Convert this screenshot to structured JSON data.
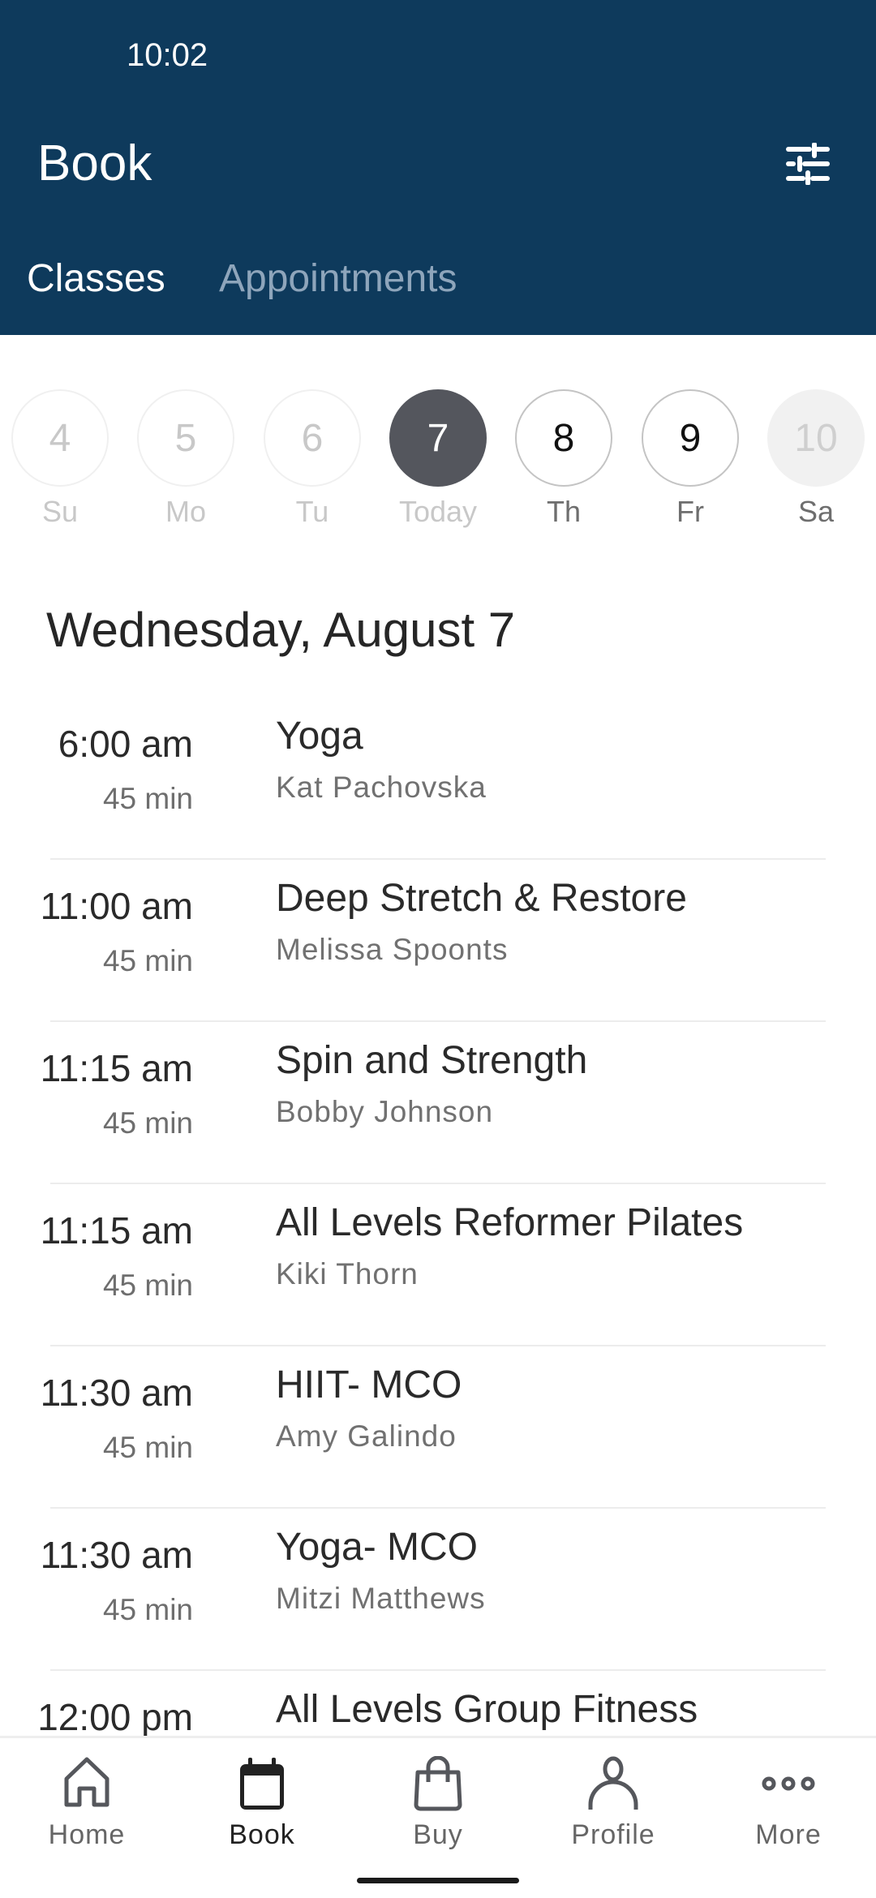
{
  "status_bar": {
    "time": "10:02"
  },
  "header": {
    "title": "Book",
    "filter_icon": "sliders-icon"
  },
  "tabs": [
    {
      "label": "Classes",
      "active": true
    },
    {
      "label": "Appointments",
      "active": false
    }
  ],
  "days": [
    {
      "num": "4",
      "label": "Su",
      "state": "past"
    },
    {
      "num": "5",
      "label": "Mo",
      "state": "past"
    },
    {
      "num": "6",
      "label": "Tu",
      "state": "past"
    },
    {
      "num": "7",
      "label": "Today",
      "state": "selected"
    },
    {
      "num": "8",
      "label": "Th",
      "state": "future"
    },
    {
      "num": "9",
      "label": "Fr",
      "state": "future"
    },
    {
      "num": "10",
      "label": "Sa",
      "state": "disabled"
    }
  ],
  "date_heading": "Wednesday, August 7",
  "classes": [
    {
      "time": "6:00 am",
      "duration": "45 min",
      "name": "Yoga",
      "instructor": "Kat Pachovska"
    },
    {
      "time": "11:00 am",
      "duration": "45 min",
      "name": "Deep Stretch & Restore",
      "instructor": "Melissa Spoonts"
    },
    {
      "time": "11:15 am",
      "duration": "45 min",
      "name": "Spin and Strength",
      "instructor": "Bobby Johnson"
    },
    {
      "time": "11:15 am",
      "duration": "45 min",
      "name": "All Levels Reformer Pilates",
      "instructor": "Kiki Thorn"
    },
    {
      "time": "11:30 am",
      "duration": "45 min",
      "name": "HIIT- MCO",
      "instructor": "Amy Galindo"
    },
    {
      "time": "11:30 am",
      "duration": "45 min",
      "name": "Yoga- MCO",
      "instructor": "Mitzi Matthews"
    },
    {
      "time": "12:00 pm",
      "duration": "",
      "name": "All Levels Group Fitness",
      "instructor": ""
    }
  ],
  "nav": [
    {
      "label": "Home",
      "icon": "home-icon"
    },
    {
      "label": "Book",
      "icon": "calendar-icon",
      "active": true
    },
    {
      "label": "Buy",
      "icon": "shopping-bag-icon"
    },
    {
      "label": "Profile",
      "icon": "person-icon"
    },
    {
      "label": "More",
      "icon": "more-dots-icon"
    }
  ],
  "colors": {
    "header_bg": "#0e3a5c",
    "selected_day": "#54565d"
  }
}
